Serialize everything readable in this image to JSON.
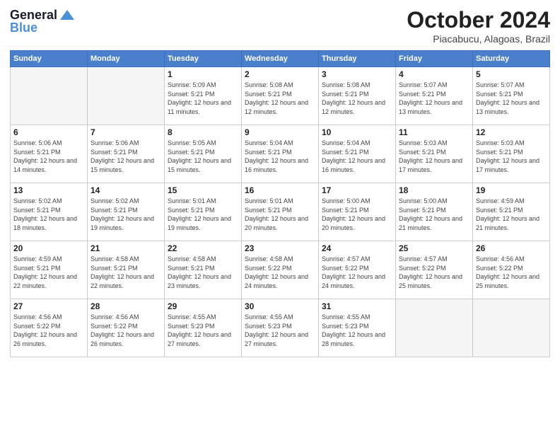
{
  "header": {
    "logo_line1": "General",
    "logo_line2": "Blue",
    "month": "October 2024",
    "location": "Piacabucu, Alagoas, Brazil"
  },
  "weekdays": [
    "Sunday",
    "Monday",
    "Tuesday",
    "Wednesday",
    "Thursday",
    "Friday",
    "Saturday"
  ],
  "weeks": [
    [
      {
        "day": "",
        "info": ""
      },
      {
        "day": "",
        "info": ""
      },
      {
        "day": "1",
        "info": "Sunrise: 5:09 AM\nSunset: 5:21 PM\nDaylight: 12 hours and 11 minutes."
      },
      {
        "day": "2",
        "info": "Sunrise: 5:08 AM\nSunset: 5:21 PM\nDaylight: 12 hours and 12 minutes."
      },
      {
        "day": "3",
        "info": "Sunrise: 5:08 AM\nSunset: 5:21 PM\nDaylight: 12 hours and 12 minutes."
      },
      {
        "day": "4",
        "info": "Sunrise: 5:07 AM\nSunset: 5:21 PM\nDaylight: 12 hours and 13 minutes."
      },
      {
        "day": "5",
        "info": "Sunrise: 5:07 AM\nSunset: 5:21 PM\nDaylight: 12 hours and 13 minutes."
      }
    ],
    [
      {
        "day": "6",
        "info": "Sunrise: 5:06 AM\nSunset: 5:21 PM\nDaylight: 12 hours and 14 minutes."
      },
      {
        "day": "7",
        "info": "Sunrise: 5:06 AM\nSunset: 5:21 PM\nDaylight: 12 hours and 15 minutes."
      },
      {
        "day": "8",
        "info": "Sunrise: 5:05 AM\nSunset: 5:21 PM\nDaylight: 12 hours and 15 minutes."
      },
      {
        "day": "9",
        "info": "Sunrise: 5:04 AM\nSunset: 5:21 PM\nDaylight: 12 hours and 16 minutes."
      },
      {
        "day": "10",
        "info": "Sunrise: 5:04 AM\nSunset: 5:21 PM\nDaylight: 12 hours and 16 minutes."
      },
      {
        "day": "11",
        "info": "Sunrise: 5:03 AM\nSunset: 5:21 PM\nDaylight: 12 hours and 17 minutes."
      },
      {
        "day": "12",
        "info": "Sunrise: 5:03 AM\nSunset: 5:21 PM\nDaylight: 12 hours and 17 minutes."
      }
    ],
    [
      {
        "day": "13",
        "info": "Sunrise: 5:02 AM\nSunset: 5:21 PM\nDaylight: 12 hours and 18 minutes."
      },
      {
        "day": "14",
        "info": "Sunrise: 5:02 AM\nSunset: 5:21 PM\nDaylight: 12 hours and 19 minutes."
      },
      {
        "day": "15",
        "info": "Sunrise: 5:01 AM\nSunset: 5:21 PM\nDaylight: 12 hours and 19 minutes."
      },
      {
        "day": "16",
        "info": "Sunrise: 5:01 AM\nSunset: 5:21 PM\nDaylight: 12 hours and 20 minutes."
      },
      {
        "day": "17",
        "info": "Sunrise: 5:00 AM\nSunset: 5:21 PM\nDaylight: 12 hours and 20 minutes."
      },
      {
        "day": "18",
        "info": "Sunrise: 5:00 AM\nSunset: 5:21 PM\nDaylight: 12 hours and 21 minutes."
      },
      {
        "day": "19",
        "info": "Sunrise: 4:59 AM\nSunset: 5:21 PM\nDaylight: 12 hours and 21 minutes."
      }
    ],
    [
      {
        "day": "20",
        "info": "Sunrise: 4:59 AM\nSunset: 5:21 PM\nDaylight: 12 hours and 22 minutes."
      },
      {
        "day": "21",
        "info": "Sunrise: 4:58 AM\nSunset: 5:21 PM\nDaylight: 12 hours and 22 minutes."
      },
      {
        "day": "22",
        "info": "Sunrise: 4:58 AM\nSunset: 5:21 PM\nDaylight: 12 hours and 23 minutes."
      },
      {
        "day": "23",
        "info": "Sunrise: 4:58 AM\nSunset: 5:22 PM\nDaylight: 12 hours and 24 minutes."
      },
      {
        "day": "24",
        "info": "Sunrise: 4:57 AM\nSunset: 5:22 PM\nDaylight: 12 hours and 24 minutes."
      },
      {
        "day": "25",
        "info": "Sunrise: 4:57 AM\nSunset: 5:22 PM\nDaylight: 12 hours and 25 minutes."
      },
      {
        "day": "26",
        "info": "Sunrise: 4:56 AM\nSunset: 5:22 PM\nDaylight: 12 hours and 25 minutes."
      }
    ],
    [
      {
        "day": "27",
        "info": "Sunrise: 4:56 AM\nSunset: 5:22 PM\nDaylight: 12 hours and 26 minutes."
      },
      {
        "day": "28",
        "info": "Sunrise: 4:56 AM\nSunset: 5:22 PM\nDaylight: 12 hours and 26 minutes."
      },
      {
        "day": "29",
        "info": "Sunrise: 4:55 AM\nSunset: 5:23 PM\nDaylight: 12 hours and 27 minutes."
      },
      {
        "day": "30",
        "info": "Sunrise: 4:55 AM\nSunset: 5:23 PM\nDaylight: 12 hours and 27 minutes."
      },
      {
        "day": "31",
        "info": "Sunrise: 4:55 AM\nSunset: 5:23 PM\nDaylight: 12 hours and 28 minutes."
      },
      {
        "day": "",
        "info": ""
      },
      {
        "day": "",
        "info": ""
      }
    ]
  ]
}
